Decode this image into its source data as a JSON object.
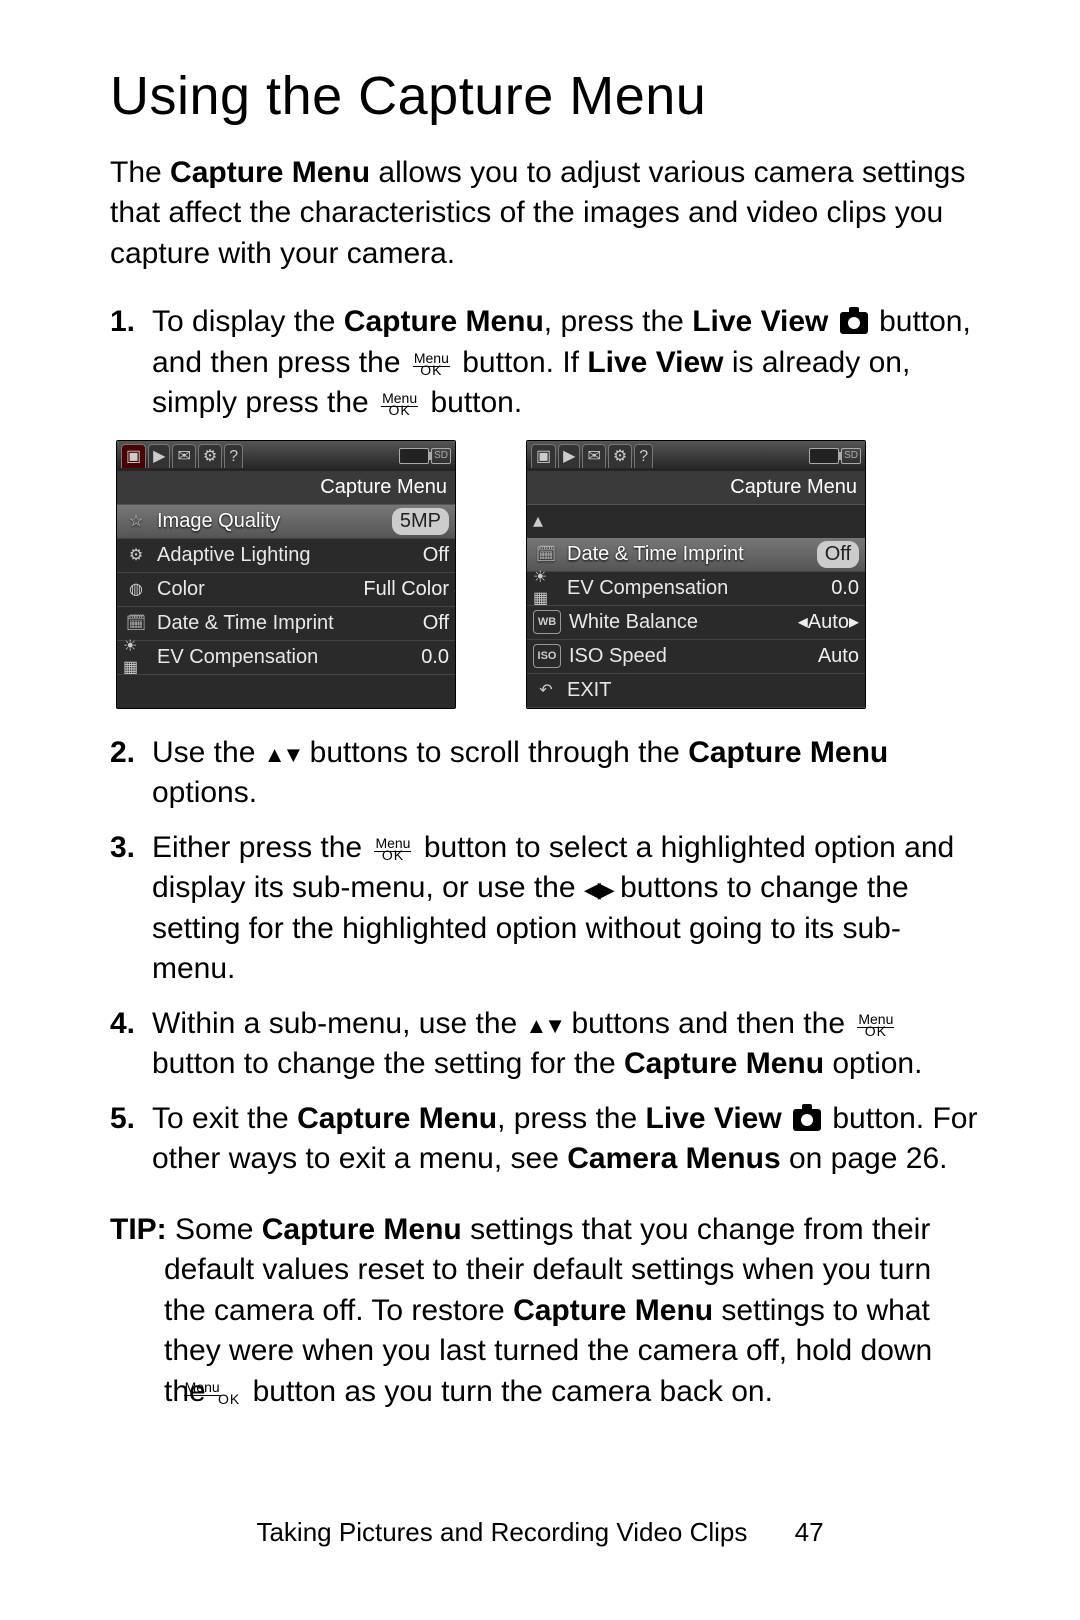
{
  "heading": "Using the Capture Menu",
  "intro": {
    "pre": "The ",
    "bold1": "Capture Menu",
    "post": " allows you to adjust various camera settings that affect the characteristics of the images and video clips you capture with your camera."
  },
  "menuok": {
    "top": "Menu",
    "bottom": "OK"
  },
  "steps": {
    "s1": {
      "a": "To display the ",
      "b": "Capture Menu",
      "c": ", press the ",
      "d": "Live View",
      "e": " button, and then press the ",
      "f": " button. If ",
      "g": "Live View",
      "h": " is already on, simply press the ",
      "i": " button."
    },
    "s2": {
      "a": "Use the ",
      "b": " buttons to scroll through the ",
      "c": "Capture Menu",
      "d": " options."
    },
    "s3": {
      "a": "Either press the ",
      "b": " button to select a highlighted option and display its sub-menu, or use the ",
      "c": " buttons to change the setting for the highlighted option without going to its sub-menu."
    },
    "s4": {
      "a": "Within a sub-menu, use the ",
      "b": " buttons and then the ",
      "c": " button to change the setting for the ",
      "d": "Capture Menu",
      "e": " option."
    },
    "s5": {
      "a": "To exit the ",
      "b": "Capture Menu",
      "c": ", press the ",
      "d": "Live View",
      "e": " button. For other ways to exit a menu, see ",
      "f": "Camera Menus",
      "g": " on page 26."
    }
  },
  "tip": {
    "label": "TIP:",
    "a": " Some ",
    "b": "Capture Menu",
    "c": " settings that you change from their default values reset to their default settings when you turn the camera off. To restore ",
    "d": "Capture Menu",
    "e": " settings to what they were when you last turned the camera off, hold down the ",
    "f": " button as you turn the camera back on."
  },
  "screen_left": {
    "title": "Capture Menu",
    "rows": [
      {
        "icon": "☆",
        "label": "Image Quality",
        "value": "5MP",
        "selected": true
      },
      {
        "icon": "⚙",
        "label": "Adaptive Lighting",
        "value": "Off",
        "selected": false
      },
      {
        "icon": "◍",
        "label": "Color",
        "value": "Full Color",
        "selected": false
      },
      {
        "icon": "🗓",
        "label": "Date & Time Imprint",
        "value": "Off",
        "selected": false
      },
      {
        "icon": "☀▦",
        "label": "EV Compensation",
        "value": "0.0",
        "selected": false
      }
    ]
  },
  "screen_right": {
    "title": "Capture Menu",
    "rows": [
      {
        "icon": "🗓",
        "label": "Date & Time Imprint",
        "value": "Off",
        "selected": true
      },
      {
        "icon": "☀▦",
        "label": "EV Compensation",
        "value": "0.0",
        "selected": false
      },
      {
        "icon": "WB",
        "label": "White Balance",
        "value": "◂Auto▸",
        "selected": false,
        "box": true
      },
      {
        "icon": "ISO",
        "label": "ISO Speed",
        "value": "Auto",
        "selected": false,
        "box": true
      },
      {
        "icon": "↶",
        "label": "EXIT",
        "value": "",
        "selected": false
      }
    ]
  },
  "footer": {
    "section": "Taking Pictures and Recording Video Clips",
    "page": "47"
  }
}
